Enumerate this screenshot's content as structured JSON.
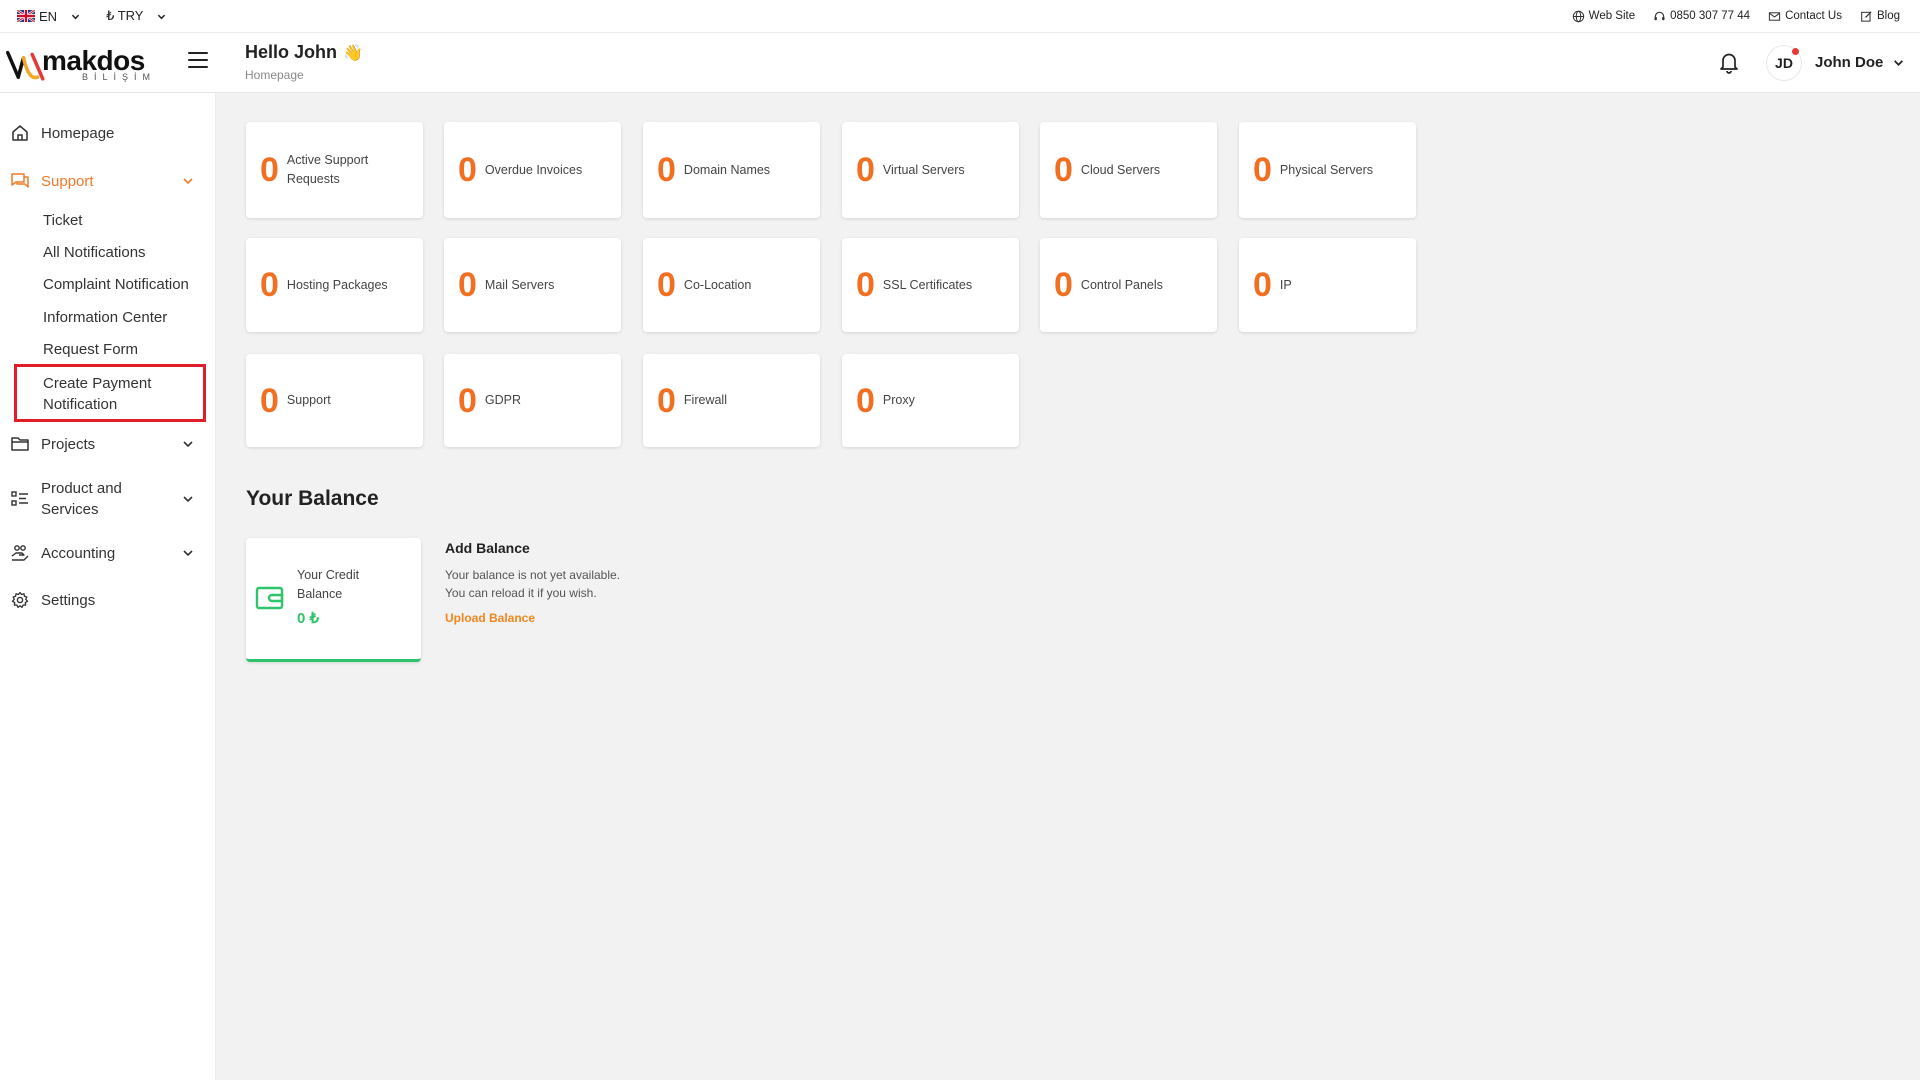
{
  "topbar": {
    "language": "EN",
    "currency": "₺ TRY",
    "links": [
      {
        "icon": "globe-icon",
        "label": "Web Site"
      },
      {
        "icon": "headset-icon",
        "label": "0850 307 77 44"
      },
      {
        "icon": "mail-icon",
        "label": "Contact Us"
      },
      {
        "icon": "edit-icon",
        "label": "Blog"
      }
    ]
  },
  "header": {
    "logo_main": "makdos",
    "logo_sub": "BİLİŞİM",
    "greeting": "Hello John",
    "greeting_emoji": "👋",
    "breadcrumb": "Homepage",
    "avatar_initials": "JD",
    "user_name": "John Doe"
  },
  "sidebar": {
    "items": [
      {
        "label": "Homepage",
        "icon": "home-icon"
      },
      {
        "label": "Support",
        "icon": "chat-icon"
      },
      {
        "label": "Projects",
        "icon": "folder-icon"
      },
      {
        "label": "Product and Services",
        "icon": "list-icon"
      },
      {
        "label": "Accounting",
        "icon": "accounting-icon"
      },
      {
        "label": "Settings",
        "icon": "gear-icon"
      }
    ],
    "support_sub": [
      {
        "label": "Ticket"
      },
      {
        "label": "All Notifications"
      },
      {
        "label": "Complaint Notification"
      },
      {
        "label": "Information Center"
      },
      {
        "label": "Request Form"
      },
      {
        "label": "Create Payment Notification"
      }
    ]
  },
  "cards": [
    {
      "count": "0",
      "label": "Active Support Requests"
    },
    {
      "count": "0",
      "label": "Overdue Invoices"
    },
    {
      "count": "0",
      "label": "Domain Names"
    },
    {
      "count": "0",
      "label": "Virtual Servers"
    },
    {
      "count": "0",
      "label": "Cloud Servers"
    },
    {
      "count": "0",
      "label": "Physical Servers"
    },
    {
      "count": "0",
      "label": "Hosting Packages"
    },
    {
      "count": "0",
      "label": "Mail Servers"
    },
    {
      "count": "0",
      "label": "Co-Location"
    },
    {
      "count": "0",
      "label": "SSL Certificates"
    },
    {
      "count": "0",
      "label": "Control Panels"
    },
    {
      "count": "0",
      "label": "IP"
    },
    {
      "count": "0",
      "label": "Support"
    },
    {
      "count": "0",
      "label": "GDPR"
    },
    {
      "count": "0",
      "label": "Firewall"
    },
    {
      "count": "0",
      "label": "Proxy"
    }
  ],
  "balance": {
    "title": "Your Balance",
    "credit_label": "Your Credit Balance",
    "credit_value": "0 ₺",
    "add_title": "Add Balance",
    "add_text_1": "Your balance is not yet available.",
    "add_text_2": "You can reload it if you wish.",
    "add_link": "Upload Balance"
  },
  "colors": {
    "accent": "#f26f21",
    "success": "#2ec46b",
    "highlight": "#e11d2a"
  }
}
